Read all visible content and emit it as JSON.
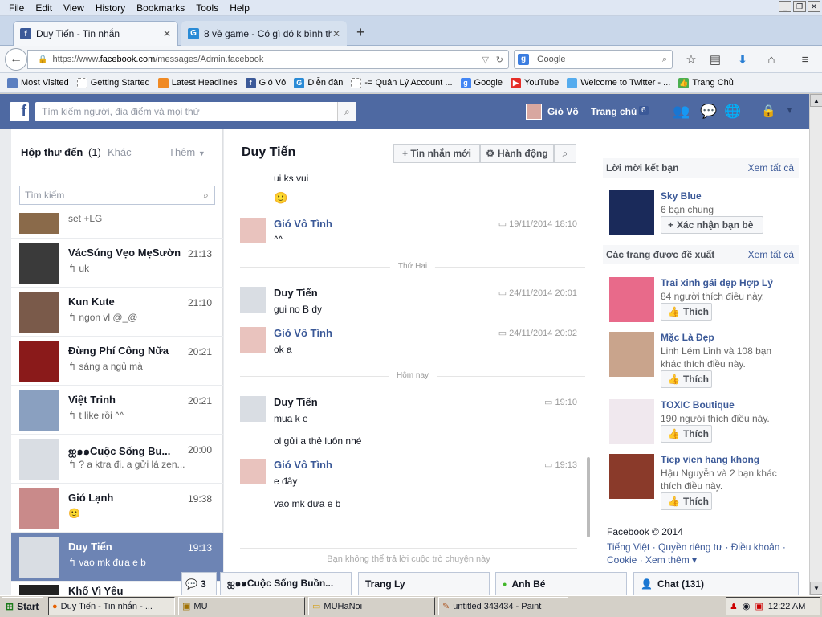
{
  "menu": [
    "File",
    "Edit",
    "View",
    "History",
    "Bookmarks",
    "Tools",
    "Help"
  ],
  "tabs": [
    {
      "title": "Duy Tiến - Tin nhắn",
      "active": true
    },
    {
      "title": "8 về game - Có gì đó k bình th...",
      "active": false
    }
  ],
  "nav": {
    "url_prefix": "https://www.",
    "url_host": "facebook.com",
    "url_path": "/messages/Admin.facebook",
    "search_placeholder": "Google"
  },
  "bookmarks": [
    "Most Visited",
    "Getting Started",
    "Latest Headlines",
    "Gió Vô",
    "Diễn đàn",
    "-= Quản Lý Account ...",
    "Google",
    "YouTube",
    "Welcome to Twitter - ...",
    "Trang Chủ"
  ],
  "fb": {
    "search_placeholder": "Tìm kiếm người, địa điểm và mọi thứ",
    "user_name": "Gió Vô",
    "home_label": "Trang chủ",
    "home_count": "6"
  },
  "inbox": {
    "title": "Hộp thư đến",
    "count": "(1)",
    "other": "Khác",
    "more": "Thêm",
    "search_placeholder": "Tìm kiếm",
    "partial_top_preview": "set +LG",
    "threads": [
      {
        "name": "VácSúng Vẹo MẹSườn",
        "time": "21:13",
        "preview": "↰ uk"
      },
      {
        "name": "Kun Kute",
        "time": "21:10",
        "preview": "↰ ngon vl @_@"
      },
      {
        "name": "Đừng Phí Công Nữa",
        "time": "20:21",
        "preview": "↰ sáng a ngủ mà"
      },
      {
        "name": "Việt Trinh",
        "time": "20:21",
        "preview": "↰ t like rồi ^^"
      },
      {
        "name": "ஐ๑๑Cuộc Sống Bu...",
        "time": "20:00",
        "preview": "↰ ? a ktra đi. a gửi lá zen..."
      },
      {
        "name": "Gió Lạnh",
        "time": "19:38",
        "preview": "🙂"
      },
      {
        "name": "Duy Tiến",
        "time": "19:13",
        "preview": "↰ vao mk đưa e b"
      }
    ],
    "partial_bottom_name": "Khổ Vì Yêu"
  },
  "conversation": {
    "title": "Duy Tiến",
    "new_msg_btn": "+ Tin nhắn mới",
    "actions_btn": "Hành động",
    "partial_top": "ui ks vui",
    "partial_emoji": "🙂",
    "messages": [
      {
        "sender": "Gió Vô Tình",
        "time": "19/11/2014 18:10",
        "lines": [
          "^^"
        ]
      },
      {
        "sender": "Duy Tiến",
        "time": "24/11/2014 20:01",
        "lines": [
          "gui no B dy"
        ]
      },
      {
        "sender": "Gió Vô Tình",
        "time": "24/11/2014 20:02",
        "lines": [
          "ok a"
        ]
      },
      {
        "sender": "Duy Tiến",
        "time": "19:10",
        "lines": [
          "mua k e",
          "ol gửi a thẻ luôn nhé"
        ]
      },
      {
        "sender": "Gió Vô Tình",
        "time": "19:13",
        "lines": [
          "e đây",
          "vao mk đưa e b"
        ]
      }
    ],
    "divider1": "Thứ Hai",
    "divider2": "Hôm nay",
    "footer_note": "Bạn không thể trả lời cuộc trò chuyện này"
  },
  "right": {
    "friend_requests": "Lời mời kết bạn",
    "see_all": "Xem tất cả",
    "friend": {
      "name": "Sky Blue",
      "mutual": "6 bạn chung",
      "confirm": "Xác nhận bạn bè"
    },
    "suggested_pages": "Các trang được đề xuất",
    "pages": [
      {
        "name": "Trai xinh gái đẹp Hợp Lý",
        "sub": "84 người thích điều này.",
        "like": "Thích"
      },
      {
        "name": "Mặc Là Đẹp",
        "sub": "Linh Lém Lỉnh và 108 bạn khác thích điều này.",
        "like": "Thích"
      },
      {
        "name": "TOXIC Boutique",
        "sub": "190 người thích điều này.",
        "like": "Thích"
      },
      {
        "name": "Tiep vien hang khong",
        "sub": "Hậu Nguyễn và 2 bạn khác thích điều này.",
        "like": "Thích"
      }
    ],
    "footer_copy": "Facebook © 2014",
    "footer_links": "Tiếng Việt · Quyền riêng tư · Điều khoản · Cookie · Xem thêm ▾"
  },
  "chatdock": {
    "notif_count": "3",
    "tabs": [
      "ஐ๑๑Cuộc Sống Buồn...",
      "Trang Ly",
      "Anh Bé"
    ],
    "chat_label": "Chat (131)"
  },
  "taskbar": {
    "start": "Start",
    "items": [
      "Duy Tiến - Tin nhắn - ...",
      "MU",
      "MUHaNoi",
      "untitled 343434 - Paint"
    ],
    "clock": "12:22 AM"
  }
}
